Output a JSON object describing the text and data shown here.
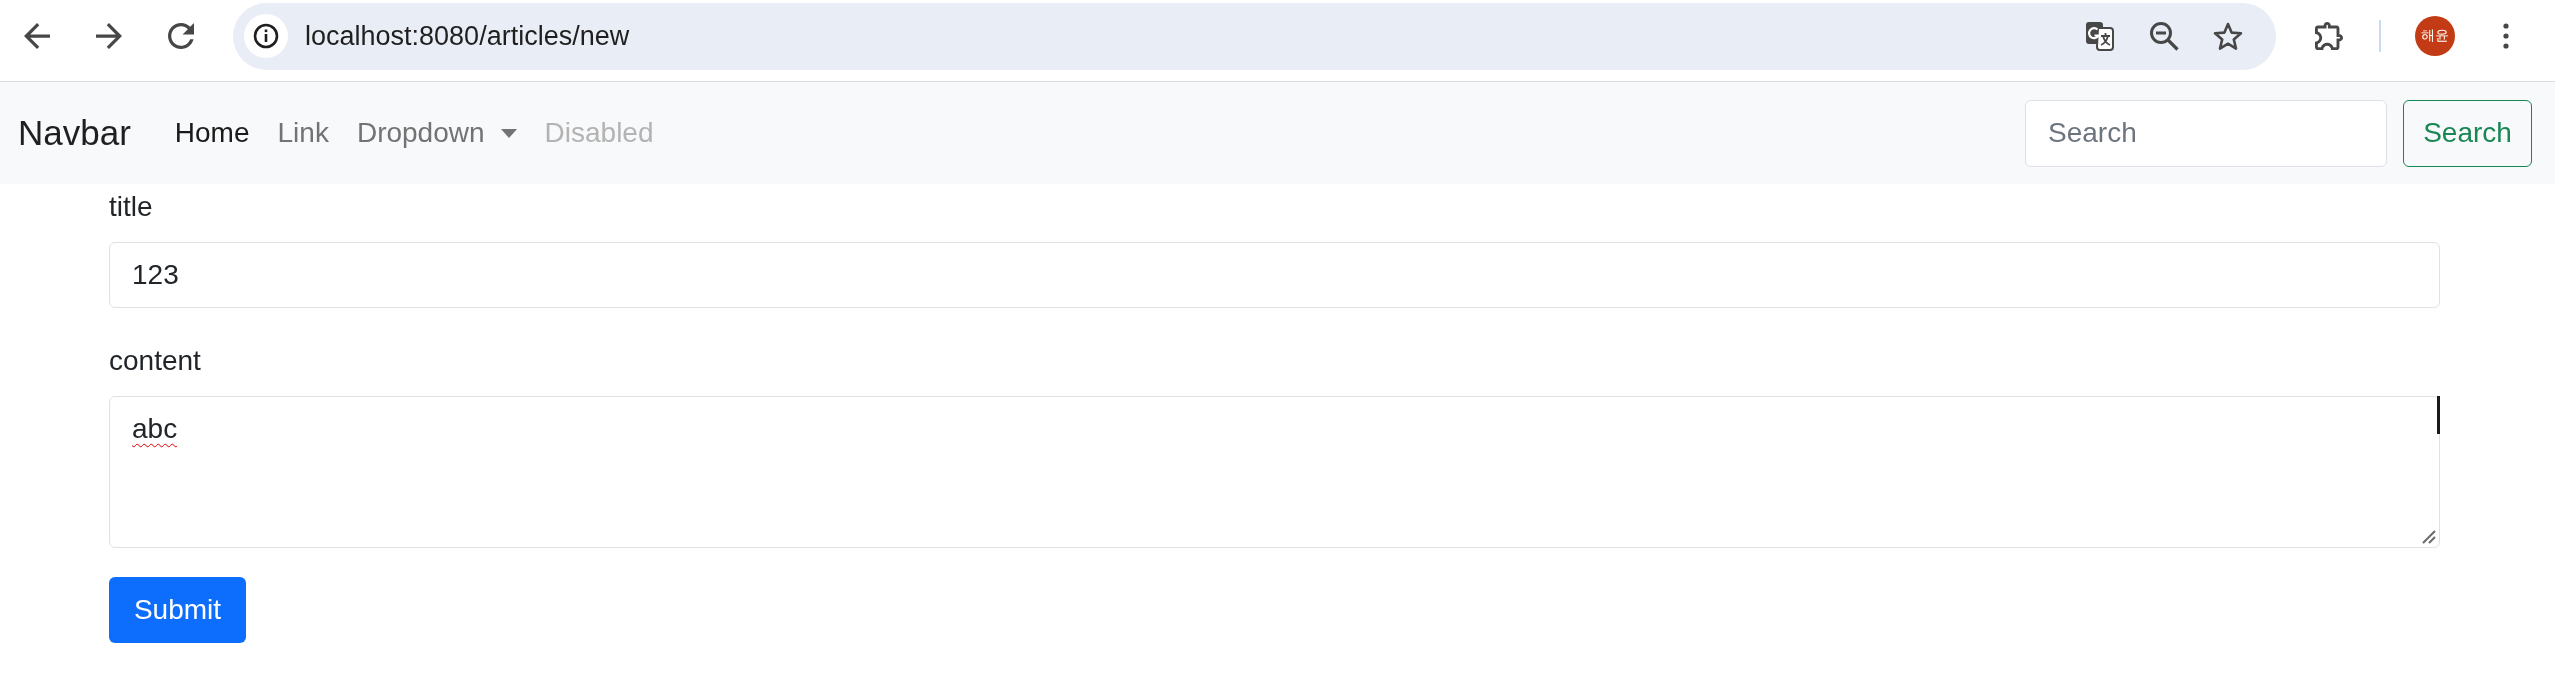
{
  "browser": {
    "url": "localhost:8080/articles/new",
    "profile": "해윤"
  },
  "navbar": {
    "brand": "Navbar",
    "items": [
      {
        "label": "Home",
        "kind": "link",
        "selected": true,
        "disabled": false
      },
      {
        "label": "Link",
        "kind": "link",
        "selected": false,
        "disabled": false
      },
      {
        "label": "Dropdown",
        "kind": "dropdown",
        "selected": false,
        "disabled": false
      },
      {
        "label": "Disabled",
        "kind": "link",
        "selected": false,
        "disabled": true
      }
    ],
    "search": {
      "placeholder": "Search",
      "button": "Search"
    }
  },
  "form": {
    "fields": [
      {
        "label": "title",
        "kind": "input",
        "value": "123",
        "misspelled": false
      },
      {
        "label": "content",
        "kind": "textarea",
        "value": "abc",
        "misspelled": true
      }
    ],
    "submit": "Submit"
  }
}
